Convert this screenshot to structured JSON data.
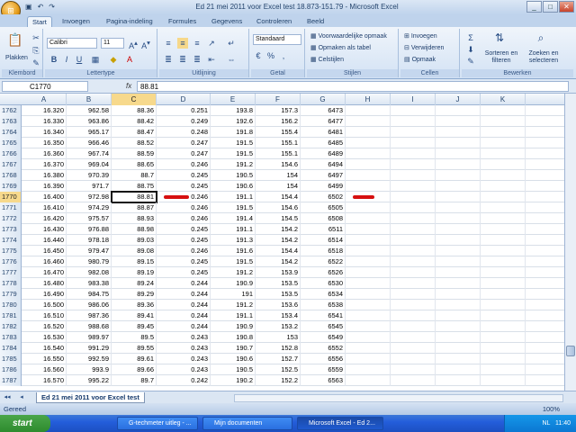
{
  "window": {
    "title": "Ed 21 mei 2011 voor Excel test 18.873-151.79 - Microsoft Excel"
  },
  "tabs": [
    "Start",
    "Invoegen",
    "Pagina-indeling",
    "Formules",
    "Gegevens",
    "Controleren",
    "Beeld"
  ],
  "ribbon": {
    "clipboard": {
      "title": "Klembord",
      "paste": "Plakken"
    },
    "font": {
      "title": "Lettertype",
      "name": "Calibri",
      "size": "11"
    },
    "align": {
      "title": "Uitlijning"
    },
    "number": {
      "title": "Getal",
      "format": "Standaard"
    },
    "styles": {
      "title": "Stijlen",
      "cond": "Voorwaardelijke opmaak",
      "table": "Opmaken als tabel",
      "cell": "Celstijlen"
    },
    "cells": {
      "title": "Cellen",
      "insert": "Invoegen",
      "delete": "Verwijderen",
      "format": "Opmaak"
    },
    "edit": {
      "title": "Bewerken",
      "sort": "Sorteren en filteren",
      "find": "Zoeken en selecteren"
    }
  },
  "formula_bar": {
    "name_box": "C1770",
    "fx": "fx",
    "value": "88.81"
  },
  "columns": [
    "A",
    "B",
    "C",
    "D",
    "E",
    "F",
    "G",
    "H",
    "I",
    "J",
    "K"
  ],
  "rows": [
    {
      "n": "1762",
      "a": "16.320",
      "b": "962.58",
      "c": "88.36",
      "d": "0.251",
      "e": "193.8",
      "f": "157.3",
      "g": "6473"
    },
    {
      "n": "1763",
      "a": "16.330",
      "b": "963.86",
      "c": "88.42",
      "d": "0.249",
      "e": "192.6",
      "f": "156.2",
      "g": "6477"
    },
    {
      "n": "1764",
      "a": "16.340",
      "b": "965.17",
      "c": "88.47",
      "d": "0.248",
      "e": "191.8",
      "f": "155.4",
      "g": "6481"
    },
    {
      "n": "1765",
      "a": "16.350",
      "b": "966.46",
      "c": "88.52",
      "d": "0.247",
      "e": "191.5",
      "f": "155.1",
      "g": "6485"
    },
    {
      "n": "1766",
      "a": "16.360",
      "b": "967.74",
      "c": "88.59",
      "d": "0.247",
      "e": "191.5",
      "f": "155.1",
      "g": "6489"
    },
    {
      "n": "1767",
      "a": "16.370",
      "b": "969.04",
      "c": "88.65",
      "d": "0.246",
      "e": "191.2",
      "f": "154.6",
      "g": "6494"
    },
    {
      "n": "1768",
      "a": "16.380",
      "b": "970.39",
      "c": "88.7",
      "d": "0.245",
      "e": "190.5",
      "f": "154",
      "g": "6497"
    },
    {
      "n": "1769",
      "a": "16.390",
      "b": "971.7",
      "c": "88.75",
      "d": "0.245",
      "e": "190.6",
      "f": "154",
      "g": "6499"
    },
    {
      "n": "1770",
      "a": "16.400",
      "b": "972.98",
      "c": "88.81",
      "d": "0.246",
      "e": "191.1",
      "f": "154.4",
      "g": "6502"
    },
    {
      "n": "1771",
      "a": "16.410",
      "b": "974.29",
      "c": "88.87",
      "d": "0.246",
      "e": "191.5",
      "f": "154.6",
      "g": "6505"
    },
    {
      "n": "1772",
      "a": "16.420",
      "b": "975.57",
      "c": "88.93",
      "d": "0.246",
      "e": "191.4",
      "f": "154.5",
      "g": "6508"
    },
    {
      "n": "1773",
      "a": "16.430",
      "b": "976.88",
      "c": "88.98",
      "d": "0.245",
      "e": "191.1",
      "f": "154.2",
      "g": "6511"
    },
    {
      "n": "1774",
      "a": "16.440",
      "b": "978.18",
      "c": "89.03",
      "d": "0.245",
      "e": "191.3",
      "f": "154.2",
      "g": "6514"
    },
    {
      "n": "1775",
      "a": "16.450",
      "b": "979.47",
      "c": "89.08",
      "d": "0.246",
      "e": "191.6",
      "f": "154.4",
      "g": "6518"
    },
    {
      "n": "1776",
      "a": "16.460",
      "b": "980.79",
      "c": "89.15",
      "d": "0.245",
      "e": "191.5",
      "f": "154.2",
      "g": "6522"
    },
    {
      "n": "1777",
      "a": "16.470",
      "b": "982.08",
      "c": "89.19",
      "d": "0.245",
      "e": "191.2",
      "f": "153.9",
      "g": "6526"
    },
    {
      "n": "1778",
      "a": "16.480",
      "b": "983.38",
      "c": "89.24",
      "d": "0.244",
      "e": "190.9",
      "f": "153.5",
      "g": "6530"
    },
    {
      "n": "1779",
      "a": "16.490",
      "b": "984.75",
      "c": "89.29",
      "d": "0.244",
      "e": "191",
      "f": "153.5",
      "g": "6534"
    },
    {
      "n": "1780",
      "a": "16.500",
      "b": "986.06",
      "c": "89.36",
      "d": "0.244",
      "e": "191.2",
      "f": "153.6",
      "g": "6538"
    },
    {
      "n": "1781",
      "a": "16.510",
      "b": "987.36",
      "c": "89.41",
      "d": "0.244",
      "e": "191.1",
      "f": "153.4",
      "g": "6541"
    },
    {
      "n": "1782",
      "a": "16.520",
      "b": "988.68",
      "c": "89.45",
      "d": "0.244",
      "e": "190.9",
      "f": "153.2",
      "g": "6545"
    },
    {
      "n": "1783",
      "a": "16.530",
      "b": "989.97",
      "c": "89.5",
      "d": "0.243",
      "e": "190.8",
      "f": "153",
      "g": "6549"
    },
    {
      "n": "1784",
      "a": "16.540",
      "b": "991.29",
      "c": "89.55",
      "d": "0.243",
      "e": "190.7",
      "f": "152.8",
      "g": "6552"
    },
    {
      "n": "1785",
      "a": "16.550",
      "b": "992.59",
      "c": "89.61",
      "d": "0.243",
      "e": "190.6",
      "f": "152.7",
      "g": "6556"
    },
    {
      "n": "1786",
      "a": "16.560",
      "b": "993.9",
      "c": "89.66",
      "d": "0.243",
      "e": "190.5",
      "f": "152.5",
      "g": "6559"
    },
    {
      "n": "1787",
      "a": "16.570",
      "b": "995.22",
      "c": "89.7",
      "d": "0.242",
      "e": "190.2",
      "f": "152.2",
      "g": "6563"
    }
  ],
  "sheet_tab": "Ed 21 mei 2011 voor Excel test",
  "status": {
    "text": "Gereed",
    "zoom": "100%"
  },
  "taskbar": {
    "start": "start",
    "tasks": [
      "G-techmeter uitleg - ...",
      "Mijn documenten",
      "Microsoft Excel - Ed 2..."
    ],
    "clock": "11:40",
    "lang": "NL"
  }
}
